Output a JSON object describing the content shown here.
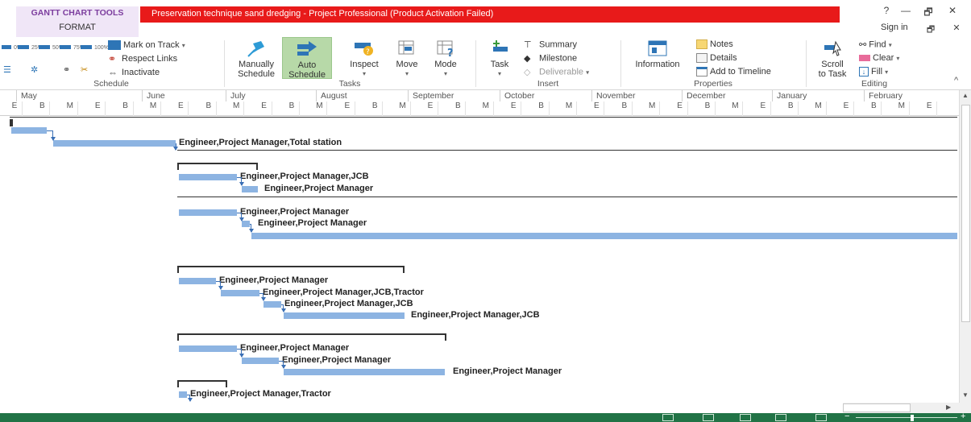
{
  "titlebar": {
    "context_tab_label": "GANTT CHART TOOLS",
    "format_tab": "FORMAT",
    "title": "Preservation technique sand dredging  -  Project Professional (Product Activation Failed)",
    "help": "?",
    "minimize": "—",
    "restore": "🗗",
    "close": "✕",
    "sign_in": "Sign in",
    "ribbon_display": "🗗",
    "ribbon_close": "✕"
  },
  "ribbon": {
    "schedule": {
      "label": "Schedule",
      "zoom_pcts": [
        "0%",
        "25%",
        "50%",
        "75%",
        "100%"
      ],
      "mark_on_track": "Mark on Track",
      "respect_links": "Respect Links",
      "inactivate": "Inactivate"
    },
    "tasks": {
      "label": "Tasks",
      "manually_line1": "Manually",
      "manually_line2": "Schedule",
      "auto_line1": "Auto",
      "auto_line2": "Schedule",
      "inspect": "Inspect",
      "move": "Move",
      "mode": "Mode"
    },
    "insert": {
      "label": "Insert",
      "task": "Task",
      "summary": "Summary",
      "milestone": "Milestone",
      "deliverable": "Deliverable"
    },
    "properties": {
      "label": "Properties",
      "information": "Information",
      "notes": "Notes",
      "details": "Details",
      "add_to_timeline": "Add to Timeline"
    },
    "editing": {
      "label": "Editing",
      "scroll_line1": "Scroll",
      "scroll_line2": "to Task",
      "find": "Find",
      "clear": "Clear",
      "fill": "Fill"
    },
    "collapse": "^"
  },
  "timescale": {
    "months": [
      "May",
      "June",
      "July",
      "August",
      "September",
      "October",
      "November",
      "December",
      "January",
      "February"
    ],
    "ticks": [
      "E",
      "B",
      "M",
      "E",
      "B",
      "M",
      "E",
      "B",
      "M",
      "E",
      "B",
      "M",
      "E",
      "B",
      "M",
      "E",
      "B",
      "M",
      "E",
      "B",
      "M",
      "E",
      "B",
      "M",
      "E",
      "B",
      "M",
      "E",
      "B",
      "M",
      "E",
      "B",
      "M",
      "E"
    ]
  },
  "chart_rows": [
    {
      "type": "summary"
    },
    {
      "type": "task"
    },
    {
      "type": "task",
      "resources": "Engineer,Project Manager,Total station"
    },
    {
      "type": "summary"
    },
    {
      "type": "task",
      "resources": "Engineer,Project Manager,JCB"
    },
    {
      "type": "task",
      "resources": "Engineer,Project Manager"
    },
    {
      "type": "summary"
    },
    {
      "type": "task",
      "resources": "Engineer,Project Manager"
    },
    {
      "type": "task",
      "resources": "Engineer,Project Manager"
    },
    {
      "type": "task"
    },
    {
      "type": "summary"
    },
    {
      "type": "task",
      "resources": "Engineer,Project Manager"
    },
    {
      "type": "task",
      "resources": "Engineer,Project Manager,JCB,Tractor"
    },
    {
      "type": "task",
      "resources": "Engineer,Project Manager,JCB"
    },
    {
      "type": "task",
      "resources": "Engineer,Project Manager,JCB"
    },
    {
      "type": "summary"
    },
    {
      "type": "task",
      "resources": "Engineer,Project Manager"
    },
    {
      "type": "task",
      "resources": "Engineer,Project Manager"
    },
    {
      "type": "task",
      "resources": "Engineer,Project Manager"
    },
    {
      "type": "summary"
    },
    {
      "type": "task",
      "resources": "Engineer,Project Manager,Tractor"
    }
  ],
  "colors": {
    "title_red": "#e81a1a",
    "context_purple": "#7c3d9e",
    "bar_blue": "#8db4e2",
    "status_green": "#217346",
    "auto_schedule_green": "#b7d9a8"
  },
  "statusbar": {
    "zoom_minus": "−",
    "zoom_plus": "+"
  }
}
